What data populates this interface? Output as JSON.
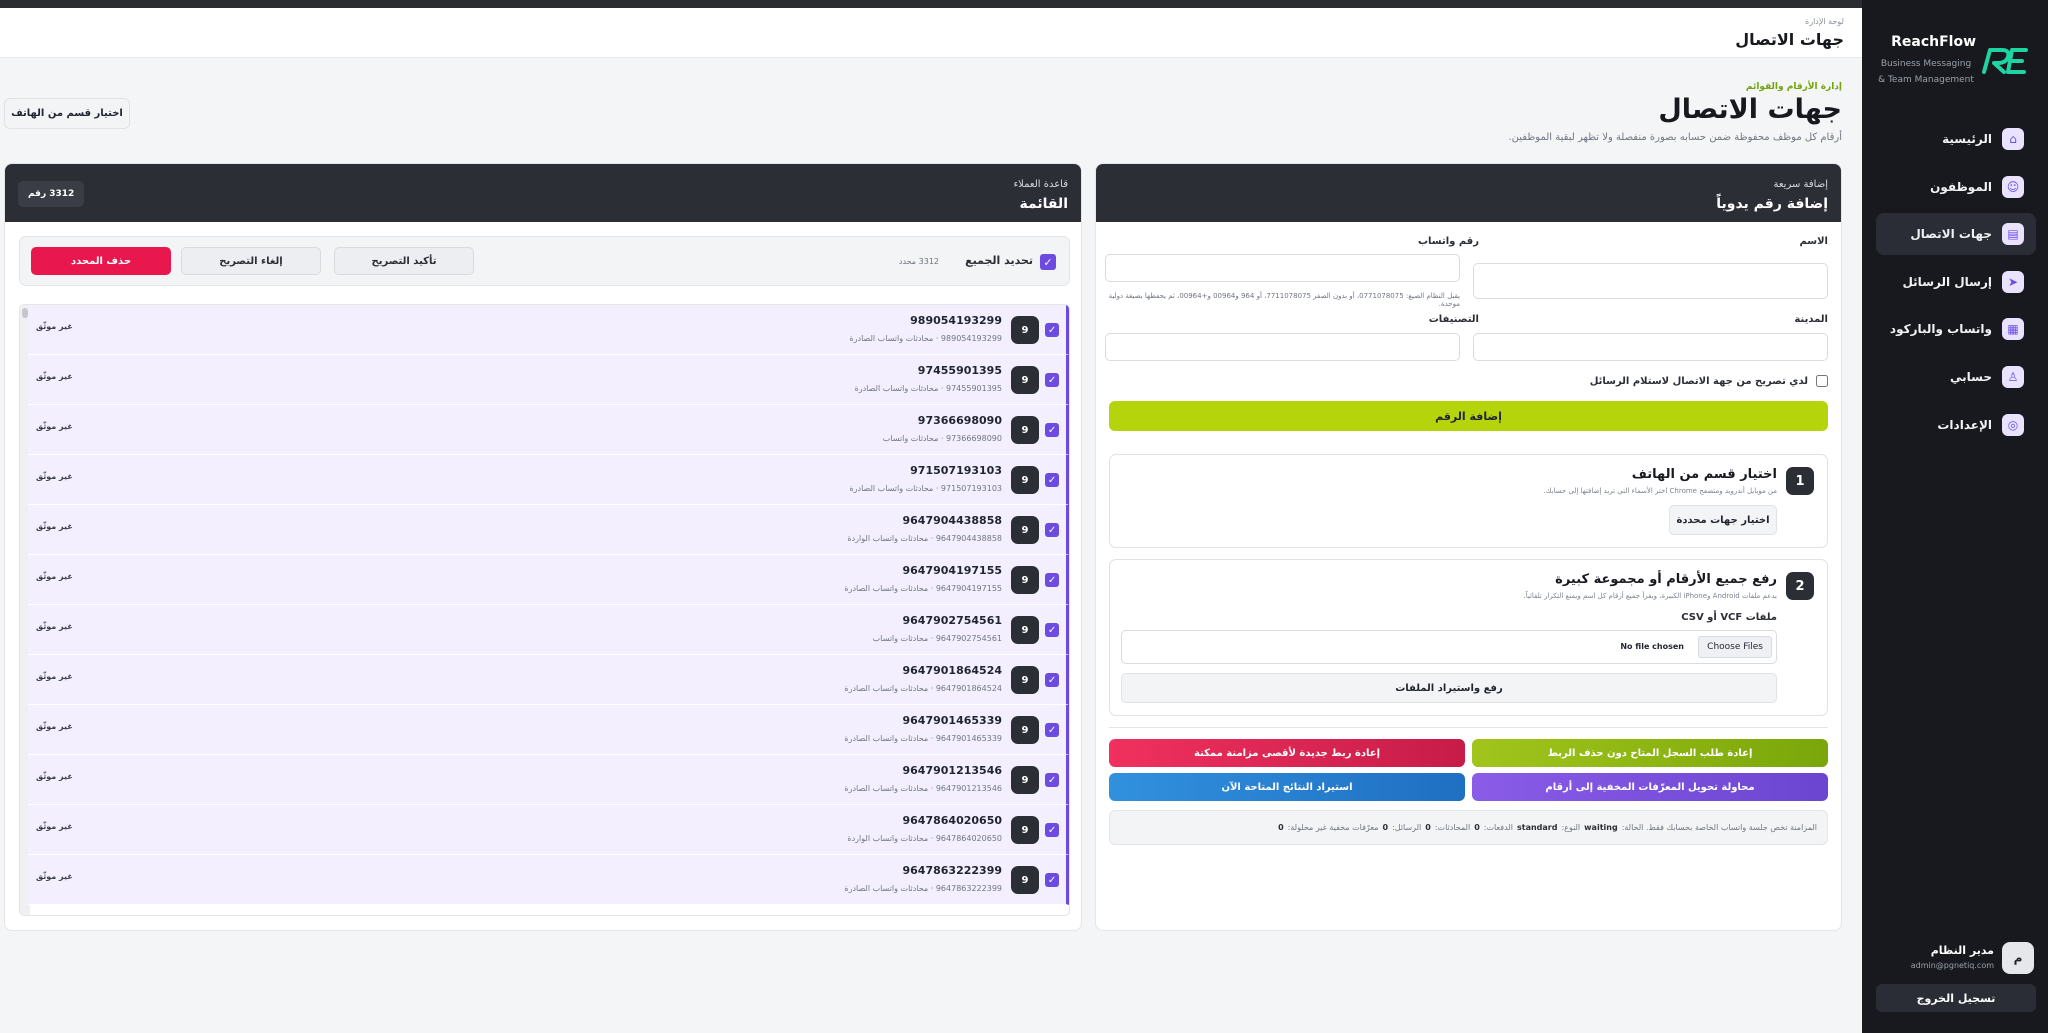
{
  "brand": {
    "name": "ReachFlow",
    "tagline": "Business Messaging & Team Management"
  },
  "sidebar": {
    "items": [
      {
        "label": "الرئيسية",
        "icon": "home-icon",
        "glyph": "⌂"
      },
      {
        "label": "الموظفون",
        "icon": "users-icon",
        "glyph": "☺"
      },
      {
        "label": "جهات الاتصال",
        "icon": "contacts-icon",
        "glyph": "▤"
      },
      {
        "label": "إرسال الرسائل",
        "icon": "send-icon",
        "glyph": "➤"
      },
      {
        "label": "واتساب والباركود",
        "icon": "qr-icon",
        "glyph": "▦"
      },
      {
        "label": "حسابي",
        "icon": "user-icon",
        "glyph": "♙"
      },
      {
        "label": "الإعدادات",
        "icon": "settings-icon",
        "glyph": "◎"
      }
    ],
    "user": {
      "avatar": "م",
      "name": "مدير النظام",
      "email": "admin@pgnetiq.com"
    },
    "logout": "تسجيل الخروج"
  },
  "header": {
    "breadcrumb": "لوحة الإدارة",
    "title": "جهات الاتصال"
  },
  "page": {
    "eyebrow": "إدارة الأرقام والقوائم",
    "title": "جهات الاتصال",
    "subtitle": "أرقام كل موظف محفوظة ضمن حسابه بصورة منفصلة ولا تظهر لبقية الموظفين.",
    "pick_button": "اختيار قسم من الهاتف"
  },
  "quick_add": {
    "eyebrow": "إضافة سريعة",
    "title": "إضافة رقم يدوياً",
    "name_label": "الاسم",
    "whatsapp_label": "رقم واتساب",
    "whatsapp_hint": "يقبل النظام الصيغ: 0771078075، أو بدون الصفر 7711078075، أو 964 و00964 و+00964، ثم يحفظها بصيغة دولية موحدة.",
    "city_label": "المدينة",
    "tags_label": "التصنيفات",
    "consent_label": "لدي تصريح من جهة الاتصال لاستلام الرسائل",
    "add_button": "إضافة الرقم",
    "step1": {
      "num": "1",
      "title": "اختيار قسم من الهاتف",
      "desc": "من موبايل أندرويد ومتصفح Chrome اختر الأسماء التي تريد إضافتها إلى حسابك.",
      "button": "اختيار جهات محددة"
    },
    "step2": {
      "num": "2",
      "title": "رفع جميع الأرقام أو مجموعة كبيرة",
      "desc": "يدعم ملفات Android وiPhone الكبيرة، ويقرأ جميع أرقام كل اسم ويمنع التكرار تلقائياً.",
      "files_label": "ملفات VCF أو CSV",
      "choose": "Choose Files",
      "no_file": "No file chosen",
      "upload_button": "رفع واستيراد الملفات"
    },
    "actions": {
      "resync": "إعادة طلب السجل المتاح دون حذف الربط",
      "relink": "إعادة ربط جديدة لأقصى مزامنة ممكنة",
      "convert": "محاولة تحويل المعرّفات المخفية إلى أرقام",
      "import": "استيراد النتائج المتاحة الآن"
    },
    "sync": {
      "prefix": "المزامنة تخص جلسة واتساب الخاصة بحسابك فقط. الحالة:",
      "state": "waiting",
      "type_label": "النوع:",
      "type": "standard",
      "batches_label": "الدفعات:",
      "batches": "0",
      "chats_label": "المحادثات:",
      "chats": "0",
      "messages_label": "الرسائل:",
      "messages": "0",
      "hidden_label": "معرّفات مخفية غير محلولة:",
      "hidden": "0"
    }
  },
  "contacts": {
    "eyebrow": "قاعدة العملاء",
    "title": "القائمة",
    "count_badge": "3312 رقم",
    "select_all": "تحديد الجميع",
    "selected_count": "3312 محدد",
    "confirm_consent": "تأكيد التصريح",
    "cancel_consent": "إلغاء التصريح",
    "delete_selected": "حذف المحدد",
    "rows": [
      {
        "phone": "989054193299",
        "meta": "989054193299 · محادثات واتساب الصادرة",
        "score": "9",
        "trust": "غير موثّق"
      },
      {
        "phone": "97455901395",
        "meta": "97455901395 · محادثات واتساب الصادرة",
        "score": "9",
        "trust": "غير موثّق"
      },
      {
        "phone": "97366698090",
        "meta": "97366698090 · محادثات واتساب",
        "score": "9",
        "trust": "غير موثّق"
      },
      {
        "phone": "971507193103",
        "meta": "971507193103 · محادثات واتساب الصادرة",
        "score": "9",
        "trust": "غير موثّق"
      },
      {
        "phone": "9647904438858",
        "meta": "9647904438858 · محادثات واتساب الواردة",
        "score": "9",
        "trust": "غير موثّق"
      },
      {
        "phone": "9647904197155",
        "meta": "9647904197155 · محادثات واتساب الصادرة",
        "score": "9",
        "trust": "غير موثّق"
      },
      {
        "phone": "9647902754561",
        "meta": "9647902754561 · محادثات واتساب",
        "score": "9",
        "trust": "غير موثّق"
      },
      {
        "phone": "9647901864524",
        "meta": "9647901864524 · محادثات واتساب الصادرة",
        "score": "9",
        "trust": "غير موثّق"
      },
      {
        "phone": "9647901465339",
        "meta": "9647901465339 · محادثات واتساب الصادرة",
        "score": "9",
        "trust": "غير موثّق"
      },
      {
        "phone": "9647901213546",
        "meta": "9647901213546 · محادثات واتساب الصادرة",
        "score": "9",
        "trust": "غير موثّق"
      },
      {
        "phone": "9647864020650",
        "meta": "9647864020650 · محادثات واتساب الواردة",
        "score": "9",
        "trust": "غير موثّق"
      },
      {
        "phone": "9647863222399",
        "meta": "9647863222399 · محادثات واتساب الصادرة",
        "score": "9",
        "trust": "غير موثّق"
      }
    ]
  },
  "colors": {
    "accent": "#6d4be0",
    "lime": "#b6d40b",
    "dark": "#2b2e35",
    "danger": "#e8184f"
  }
}
